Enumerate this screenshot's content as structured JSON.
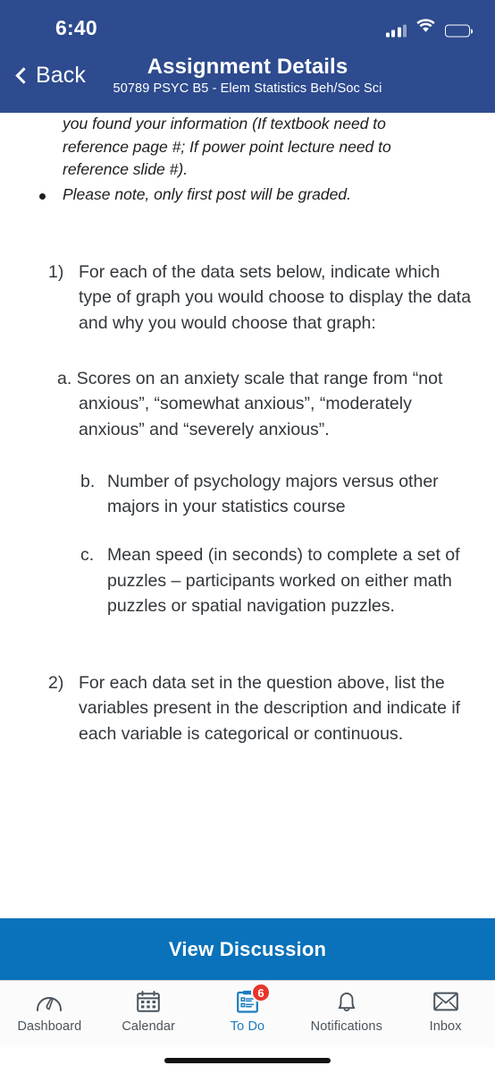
{
  "status_bar": {
    "time": "6:40",
    "signal_icon": "cellular-signal-icon",
    "wifi_icon": "wifi-icon",
    "battery_icon": "battery-low-power-icon"
  },
  "navbar": {
    "back_label": "Back",
    "back_icon": "chevron-left-icon",
    "title": "Assignment Details",
    "subtitle": "50789 PSYC B5 - Elem Statistics Beh/Soc Sci"
  },
  "content": {
    "intro_tail": [
      "you found your information (If textbook need to",
      "reference page #; If power point lecture need to",
      "reference slide #)."
    ],
    "intro_bullet": "Please note, only first post will be graded.",
    "questions": [
      {
        "number": "1)",
        "text": "For each of the data sets below, indicate which type of graph you would choose to display the data and why you would choose that graph:",
        "subitems": [
          {
            "label": "a.",
            "text": "Scores on an anxiety scale that range from “not anxious”, “somewhat anxious”, “moderately anxious” and “severely anxious”."
          },
          {
            "label": "b.",
            "text": "Number of psychology majors versus other majors in your statistics course"
          },
          {
            "label": "c.",
            "text": "Mean speed (in seconds) to complete a set of puzzles – participants worked on either math puzzles or spatial navigation puzzles."
          }
        ]
      },
      {
        "number": "2)",
        "text": "For each data set in the question above, list the variables present in the description and indicate if each variable is categorical or continuous.",
        "subitems": []
      }
    ]
  },
  "action_bar": {
    "label": "View Discussion",
    "color": "#0a72ba"
  },
  "tab_bar": {
    "tabs": [
      {
        "label": "Dashboard",
        "icon": "dashboard-gauge-icon",
        "active": false,
        "badge": ""
      },
      {
        "label": "Calendar",
        "icon": "calendar-icon",
        "active": false,
        "badge": ""
      },
      {
        "label": "To Do",
        "icon": "todo-clipboard-icon",
        "active": true,
        "badge": "6"
      },
      {
        "label": "Notifications",
        "icon": "bell-icon",
        "active": false,
        "badge": ""
      },
      {
        "label": "Inbox",
        "icon": "envelope-icon",
        "active": false,
        "badge": ""
      }
    ],
    "active_color": "#1a7dbf",
    "badge_color": "#e8342a"
  },
  "theme": {
    "header_color": "#2d4b8e",
    "accent_color": "#0a72ba",
    "text_color": "#32373c"
  }
}
